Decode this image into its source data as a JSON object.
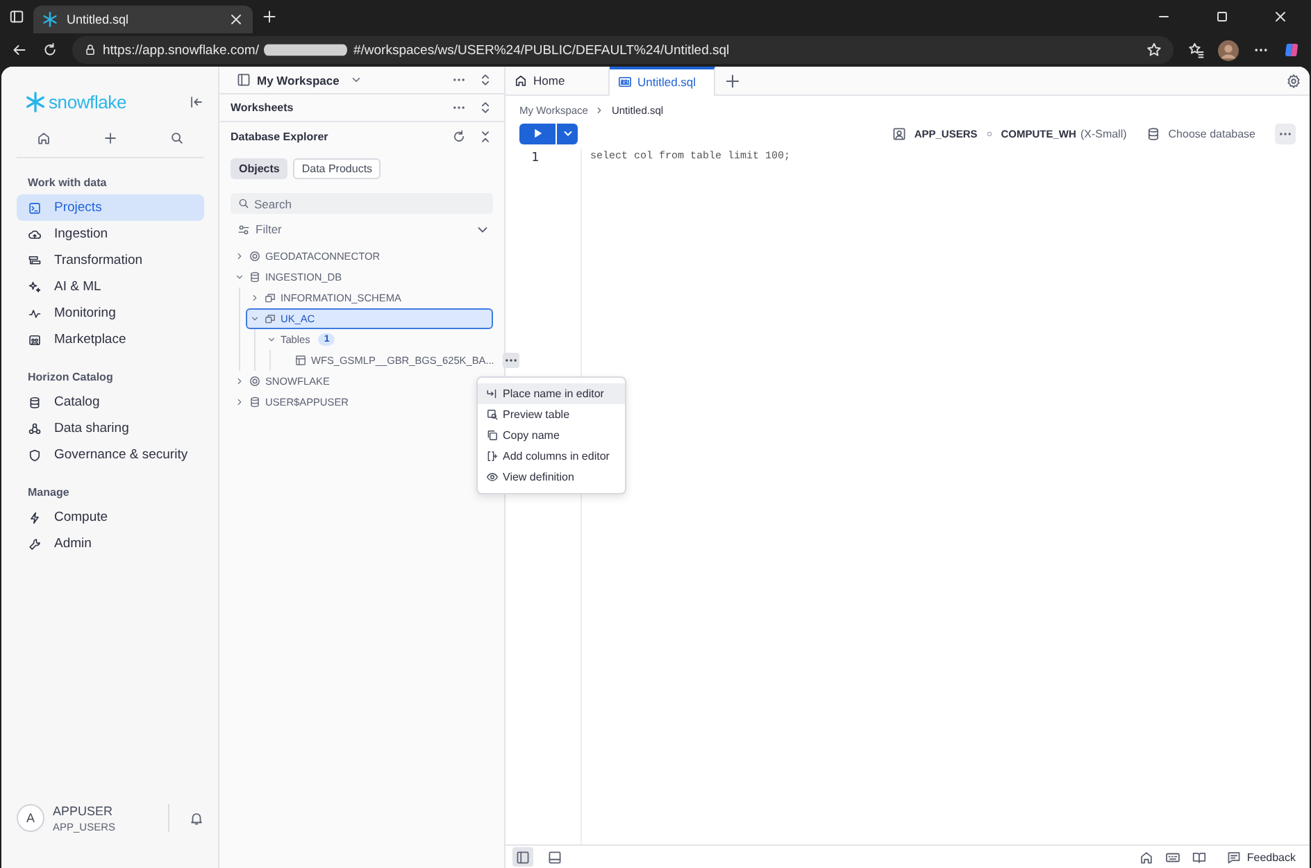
{
  "browser": {
    "tab_title": "Untitled.sql",
    "url_prefix": "https://app.snowflake.com/",
    "url_suffix": "#/workspaces/ws/USER%24/PUBLIC/DEFAULT%24/Untitled.sql"
  },
  "sidebar": {
    "logo_text": "snowflake",
    "sections": [
      {
        "heading": "Work with data",
        "items": [
          {
            "label": "Projects",
            "kind": "projects",
            "selected": true
          },
          {
            "label": "Ingestion",
            "kind": "cloud",
            "selected": false
          },
          {
            "label": "Transformation",
            "kind": "transform",
            "selected": false
          },
          {
            "label": "AI & ML",
            "kind": "sparkle",
            "selected": false
          },
          {
            "label": "Monitoring",
            "kind": "pulse",
            "selected": false
          },
          {
            "label": "Marketplace",
            "kind": "store",
            "selected": false
          }
        ]
      },
      {
        "heading": "Horizon Catalog",
        "items": [
          {
            "label": "Catalog",
            "kind": "database",
            "selected": false
          },
          {
            "label": "Data sharing",
            "kind": "share",
            "selected": false
          },
          {
            "label": "Governance & security",
            "kind": "shield",
            "selected": false
          }
        ]
      },
      {
        "heading": "Manage",
        "items": [
          {
            "label": "Compute",
            "kind": "bolt",
            "selected": false
          },
          {
            "label": "Admin",
            "kind": "wrench",
            "selected": false
          }
        ]
      }
    ],
    "user": {
      "initial": "A",
      "name": "APPUSER",
      "role": "APP_USERS"
    }
  },
  "workspace": {
    "title": "My Workspace",
    "sections": [
      "Worksheets"
    ],
    "explorer": {
      "title": "Database Explorer",
      "filter_tabs": [
        {
          "label": "Objects",
          "selected": true
        },
        {
          "label": "Data Products",
          "selected": false
        }
      ],
      "search_placeholder": "Search",
      "filter_label": "Filter",
      "tree": [
        {
          "label": "GEODATACONNECTOR",
          "kind": "app",
          "expanded": false,
          "selected": false
        },
        {
          "label": "INGESTION_DB",
          "kind": "database",
          "expanded": true,
          "selected": false,
          "children": [
            {
              "label": "INFORMATION_SCHEMA",
              "kind": "schema",
              "expanded": false,
              "selected": false
            },
            {
              "label": "UK_AC",
              "kind": "schema",
              "expanded": true,
              "selected": true,
              "children": [
                {
                  "label": "Tables",
                  "kind": "folder",
                  "count": "1",
                  "expanded": true,
                  "selected": false,
                  "children": [
                    {
                      "label": "WFS_GSMLP__GBR_BGS_625K_BA...",
                      "kind": "table",
                      "selected": false,
                      "menu_open": true
                    }
                  ]
                }
              ]
            }
          ]
        },
        {
          "label": "SNOWFLAKE",
          "kind": "app",
          "expanded": false,
          "selected": false
        },
        {
          "label": "USER$APPUSER",
          "kind": "database",
          "expanded": false,
          "selected": false
        }
      ]
    },
    "context_menu": [
      {
        "label": "Place name in editor",
        "kind": "insert",
        "selected": true
      },
      {
        "label": "Preview table",
        "kind": "preview",
        "selected": false
      },
      {
        "label": "Copy name",
        "kind": "copy",
        "selected": false
      },
      {
        "label": "Add columns in editor",
        "kind": "columns",
        "selected": false
      },
      {
        "label": "View definition",
        "kind": "eye",
        "selected": false
      }
    ]
  },
  "editor": {
    "tabs": [
      {
        "label": "Home",
        "kind": "home",
        "selected": false
      },
      {
        "label": "Untitled.sql",
        "kind": "sql",
        "selected": true
      }
    ],
    "breadcrumb": [
      "My Workspace",
      "Untitled.sql"
    ],
    "role": "APP_USERS",
    "warehouse": "COMPUTE_WH",
    "warehouse_size": "(X-Small)",
    "database": "Choose database",
    "lines": [
      {
        "number": "1",
        "code": "select col from table limit 100;"
      }
    ]
  },
  "status_bar": {
    "panels": [
      {
        "kind": "side-panel",
        "selected": true
      },
      {
        "kind": "bottom-panel",
        "selected": false
      }
    ],
    "feedback": "Feedback"
  }
}
